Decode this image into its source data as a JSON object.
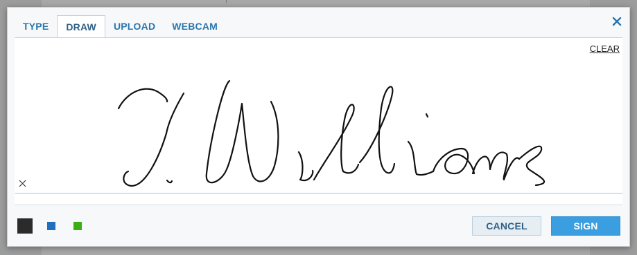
{
  "tabs": [
    {
      "label": "TYPE",
      "active": false
    },
    {
      "label": "DRAW",
      "active": true
    },
    {
      "label": "UPLOAD",
      "active": false
    },
    {
      "label": "WEBCAM",
      "active": false
    }
  ],
  "close_icon": "close-icon",
  "draw": {
    "clear_label": "CLEAR",
    "baseline_icon": "x-mark-icon"
  },
  "colors": {
    "swatches": [
      "#2b2b2b",
      "#1f6fbe",
      "#3cae15"
    ],
    "selected": "#2b2b2b",
    "accent": "#3b9ee0"
  },
  "actions": {
    "cancel_label": "CANCEL",
    "sign_label": "SIGN"
  }
}
